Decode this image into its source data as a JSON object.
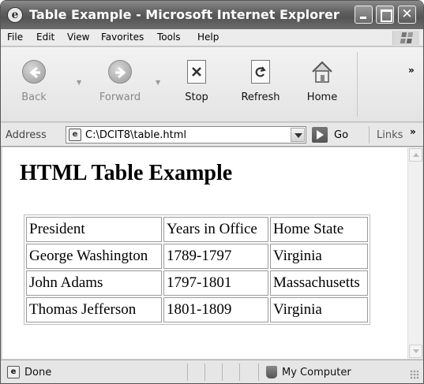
{
  "window": {
    "title": "Table Example - Microsoft Internet Explorer",
    "app_icon": "ie-icon"
  },
  "menu": {
    "items": [
      "File",
      "Edit",
      "View",
      "Favorites",
      "Tools",
      "Help"
    ]
  },
  "toolbar": {
    "back_label": "Back",
    "forward_label": "Forward",
    "stop_label": "Stop",
    "refresh_label": "Refresh",
    "home_label": "Home",
    "overflow": "»"
  },
  "address": {
    "label": "Address",
    "value": "C:\\DCIT8\\table.html",
    "go_label": "Go",
    "links_label": "Links",
    "links_overflow": "»"
  },
  "page": {
    "heading": "HTML Table Example",
    "table": {
      "rows": [
        [
          "President",
          "Years in Office",
          "Home State"
        ],
        [
          "George Washington",
          "1789-1797",
          "Virginia"
        ],
        [
          "John Adams",
          "1797-1801",
          "Massachusetts"
        ],
        [
          "Thomas Jefferson",
          "1801-1809",
          "Virginia"
        ]
      ]
    }
  },
  "status": {
    "text": "Done",
    "zone": "My Computer"
  }
}
